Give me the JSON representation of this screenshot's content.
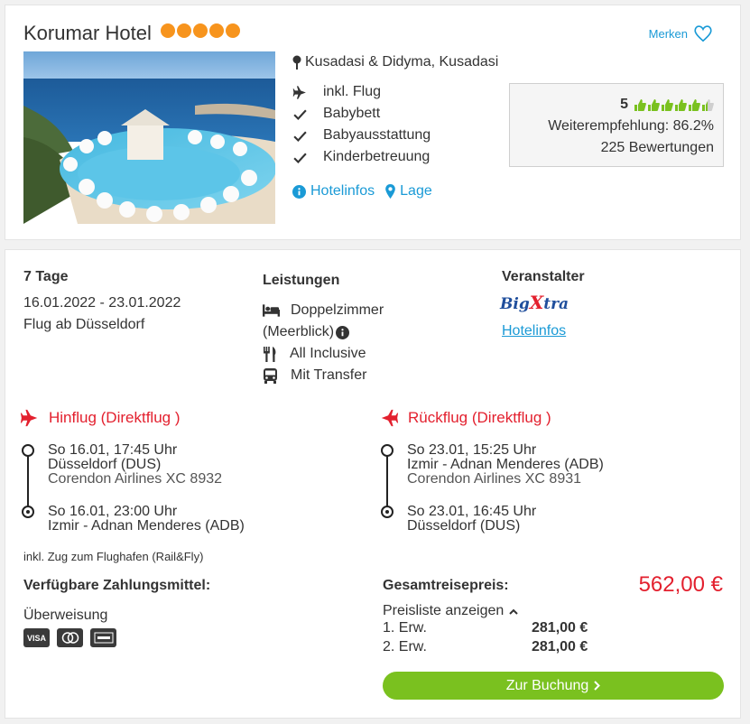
{
  "hotel": {
    "name": "Korumar Hotel",
    "stars": 5,
    "merken_label": "Merken",
    "location": "Kusadasi & Didyma, Kusadasi",
    "features": [
      {
        "icon": "plane-icon",
        "label": "inkl. Flug"
      },
      {
        "icon": "check-icon",
        "label": "Babybett"
      },
      {
        "icon": "check-icon",
        "label": "Babyausstattung"
      },
      {
        "icon": "check-icon",
        "label": "Kinderbetreuung"
      }
    ],
    "links": {
      "info": "Hotelinfos",
      "location": "Lage"
    },
    "rating": {
      "score": "5",
      "thumbs": 5.5,
      "recommendation": "Weiterempfehlung: 86.2%",
      "reviews": "225 Bewertungen"
    }
  },
  "offer": {
    "duration": "7 Tage",
    "dates": "16.01.2022 - 23.01.2022",
    "departure": "Flug ab Düsseldorf",
    "services_title": "Leistungen",
    "room_line1": "Doppelzimmer",
    "room_line2": "(Meerblick)",
    "board": "All Inclusive",
    "transfer": "Mit Transfer",
    "operator_title": "Veranstalter",
    "operator_logo_a": "Big",
    "operator_logo_b": "X",
    "operator_logo_c": "tra",
    "operator_link": "Hotelinfos"
  },
  "outbound": {
    "title": "Hinflug (Direktflug )",
    "dep_time": "So 16.01, 17:45 Uhr",
    "dep_airport": "Düsseldorf (DUS)",
    "airline": "Corendon Airlines XC 8932",
    "arr_time": "So 16.01, 23:00 Uhr",
    "arr_airport": "Izmir - Adnan Menderes (ADB)"
  },
  "return": {
    "title": "Rückflug (Direktflug )",
    "dep_time": "So 23.01, 15:25 Uhr",
    "dep_airport": "Izmir - Adnan Menderes (ADB)",
    "airline": "Corendon Airlines XC 8931",
    "arr_time": "So 23.01, 16:45 Uhr",
    "arr_airport": "Düsseldorf (DUS)"
  },
  "rail_note": "inkl. Zug zum Flughafen (Rail&Fly)",
  "payment": {
    "title": "Verfügbare Zahlungsmittel:",
    "method": "Überweisung",
    "cards": [
      "VISA",
      "mastercard",
      "american express"
    ]
  },
  "pricing": {
    "total_label": "Gesamtreisepreis:",
    "total": "562,00 €",
    "list_toggle": "Preisliste anzeigen",
    "rows": [
      {
        "label": "1. Erw.",
        "price": "281,00 €"
      },
      {
        "label": "2. Erw.",
        "price": "281,00 €"
      }
    ],
    "cta": "Zur Buchung"
  },
  "colors": {
    "accent_blue": "#1a9ad6",
    "star_orange": "#f7941d",
    "red": "#e3202e",
    "green": "#7ac11f"
  }
}
